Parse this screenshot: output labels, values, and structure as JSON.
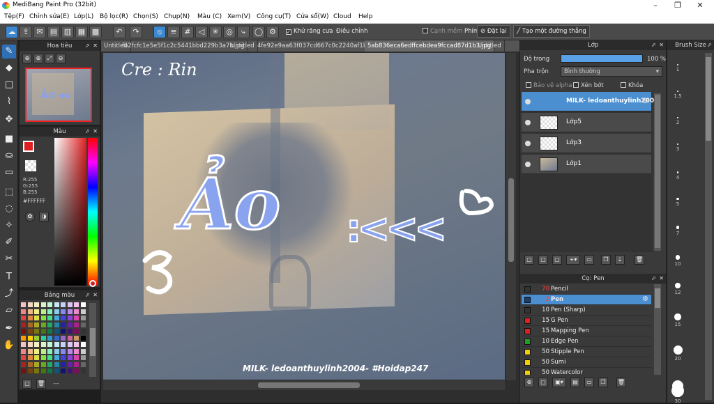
{
  "app": {
    "title": "MediBang Paint Pro (32bit)"
  },
  "menu": [
    "Tệp(F)",
    "Chỉnh sửa(E)",
    "Lớp(L)",
    "Bộ lọc(R)",
    "Chọn(S)",
    "Chụp(N)",
    "Màu (C)",
    "Xem(V)",
    "Công cụ(T)",
    "Cửa sổ(W)",
    "Cloud",
    "Help"
  ],
  "toolbar": {
    "antialias_label": "Khử răng cưa",
    "adjust_label": "Điều chỉnh",
    "adjust_value": "40",
    "edge_label": "Cạnh mềm",
    "hotkey_label": "Phím",
    "reset_label": "Đặt lại",
    "line_label": "Tạo một đường thẳng"
  },
  "tabs": [
    "Untitled",
    "fb2fcfc1e5e5f1c2c5441bbd229b3a7b.jpg",
    "Untitled",
    "4fe92e9aa63f037cd667c0c2240af1b7.gif",
    "5ab836eca6edffcebdea9fccad87d1b3.jpg",
    "Untitled"
  ],
  "navigator": {
    "title": "Hoa tiêu"
  },
  "color": {
    "title": "Màu",
    "r": "R:255",
    "g": "G:255",
    "b": "B:255",
    "hex": "#FFFFFF",
    "fg": "#e02020",
    "hue_accent": "#cc2222"
  },
  "palette": {
    "title": "Bảng màu",
    "footer": "---"
  },
  "canvas": {
    "credit": "Cre : Rin",
    "big_text": "Ảo",
    "arrows": ":<<<",
    "watermark": "MILK- ledoanthuylinh2004- #Hoidap247"
  },
  "layer": {
    "title": "Lớp",
    "opacity_label": "Độ trong",
    "opacity_value": "100 %",
    "blend_label": "Pha trộn",
    "blend_value": "Bình thường",
    "protect_alpha": "Bảo vệ alpha",
    "clipping": "Xén bớt",
    "lock": "Khóa",
    "layers": [
      {
        "name": "MILK- ledoanthuylinh2004-",
        "selected": true
      },
      {
        "name": "Lớp5",
        "selected": false
      },
      {
        "name": "Lớp3",
        "selected": false
      },
      {
        "name": "Lớp1",
        "selected": false
      }
    ]
  },
  "brush": {
    "title": "Cọ: Pen",
    "items": [
      {
        "size": "70",
        "name": "Pencil",
        "color": "#333333"
      },
      {
        "size": "2",
        "name": "Pen",
        "color": "#1a3d6e",
        "selected": true
      },
      {
        "size": "10",
        "name": "Pen (Sharp)",
        "color": "#333333"
      },
      {
        "size": "15",
        "name": "G Pen",
        "color": "#e02020"
      },
      {
        "size": "15",
        "name": "Mapping Pen",
        "color": "#e02020"
      },
      {
        "size": "10",
        "name": "Edge Pen",
        "color": "#20a020"
      },
      {
        "size": "50",
        "name": "Stipple Pen",
        "color": "#f0d000"
      },
      {
        "size": "50",
        "name": "Sumi",
        "color": "#f0d000"
      },
      {
        "size": "50",
        "name": "Watercolor",
        "color": "#f0d000"
      }
    ]
  },
  "brush_size": {
    "title": "Brush Size",
    "values": [
      "1",
      "1.5",
      "2",
      "3",
      "4",
      "5",
      "7",
      "10",
      "12",
      "15",
      "20",
      "25",
      "30"
    ]
  }
}
